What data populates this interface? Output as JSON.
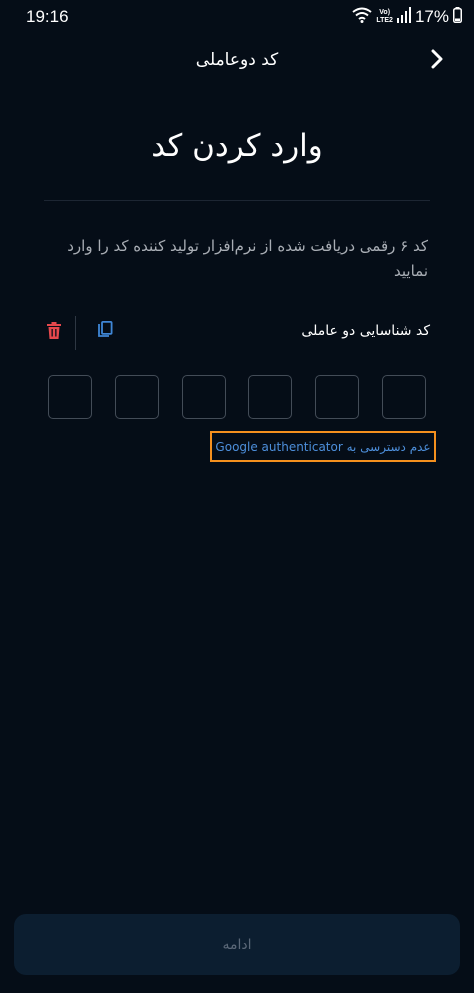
{
  "status_bar": {
    "time": "19:16",
    "lte_top": "Vo)",
    "lte_bottom": "LTE2",
    "battery": "17%"
  },
  "header": {
    "title": "کد دوعاملی",
    "back_icon": "chevron-right-icon"
  },
  "main": {
    "title": "وارد کردن کد",
    "instruction": "کد ۶ رقمی دریافت شده از نرم‌افزار تولید کننده کد را وارد نمایید",
    "field_label": "کد شناسایی دو عاملی",
    "delete_icon": "trash-icon",
    "copy_icon": "copy-icon",
    "code_digits": [
      "",
      "",
      "",
      "",
      "",
      ""
    ],
    "no_access_link": "عدم دسترسی به Google authenticator"
  },
  "footer": {
    "continue_label": "ادامه"
  },
  "colors": {
    "background": "#050d17",
    "link": "#4d8fdb",
    "delete": "#e5484d",
    "highlight": "#f5901e",
    "button_bg": "#0c1e30"
  }
}
